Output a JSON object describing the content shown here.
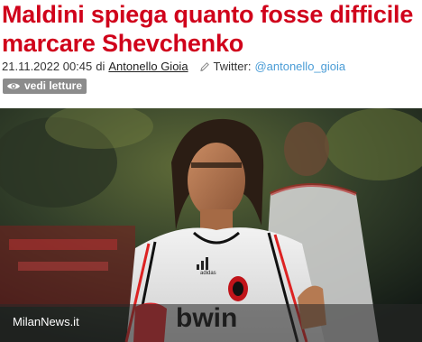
{
  "article": {
    "title": "Maldini spiega quanto fosse difficile marcare Shevchenko",
    "datetime": "21.11.2022 00:45",
    "by_word": "di",
    "author": "Antonello Gioia",
    "twitter_label": "Twitter:",
    "twitter_handle": "@antonello_gioia",
    "reads_label": "vedi letture"
  },
  "image": {
    "caption": "MilanNews.it",
    "shirt_sponsor": "bwin",
    "kit_brand_text": "adidas"
  },
  "colors": {
    "headline": "#d0021b",
    "twitter_link": "#4a9cd6",
    "badge_bg": "#8c8c8c"
  },
  "icons": {
    "pencil": "pencil-icon",
    "eye": "eye-icon"
  }
}
